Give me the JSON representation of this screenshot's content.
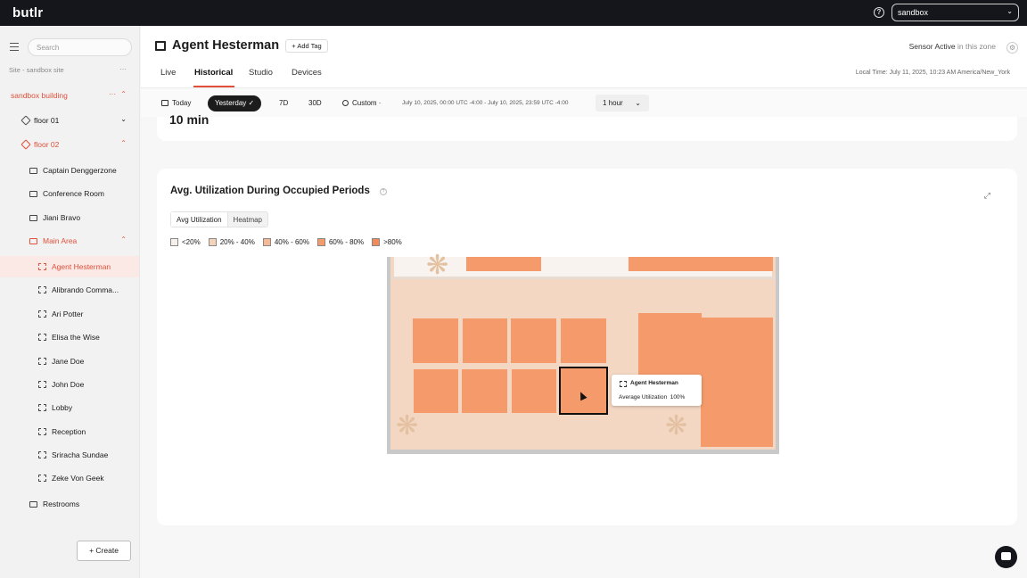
{
  "app": {
    "logo": "butlr",
    "org_select": "sandbox"
  },
  "sidebar": {
    "search_placeholder": "Search",
    "site_label": "Site - sandbox site",
    "site_more": "···",
    "building": {
      "label": "sandbox building",
      "more": "···"
    },
    "floors": [
      {
        "label": "floor 01"
      },
      {
        "label": "floor 02"
      }
    ],
    "rooms": [
      "Captain Denggerzone",
      "Conference Room",
      "Jiani Bravo"
    ],
    "main_area": "Main Area",
    "zones": [
      "Agent Hesterman",
      "Alibrando Comma...",
      "Ari Potter",
      "Elisa the Wise",
      "Jane Doe",
      "John Doe",
      "Lobby",
      "Reception",
      "Sriracha Sundae",
      "Zeke Von Geek"
    ],
    "restrooms": "Restrooms",
    "create_label": "+  Create"
  },
  "header": {
    "title": "Agent Hesterman",
    "add_tag": "+ Add Tag",
    "sensor_status": "Sensor Active",
    "sensor_suffix": " in this zone",
    "tabs": [
      "Live",
      "Historical",
      "Studio",
      "Devices"
    ],
    "active_tab": "Historical",
    "local_time": "Local Time: July 11, 2025, 10:23 AM America/New_York"
  },
  "filters": {
    "today": "Today",
    "yesterday": "Yesterday ✓",
    "seven_d": "7D",
    "thirty_d": "30D",
    "custom": "Custom ·",
    "date_range": "July 10, 2025, 00:00 UTC -4:00   -   July 10, 2025, 23:59 UTC -4:00",
    "interval": "1 hour"
  },
  "top_card": {
    "value": "10 min"
  },
  "util_card": {
    "title": "Avg. Utilization During Occupied Periods",
    "toggle": [
      "Avg Utilization",
      "Heatmap"
    ],
    "legend": [
      {
        "label": "<20%",
        "color": "#f7efe9"
      },
      {
        "label": "20% - 40%",
        "color": "#f3d3b9"
      },
      {
        "label": "40% - 60%",
        "color": "#f4b892"
      },
      {
        "label": "60% - 80%",
        "color": "#f49a6b"
      },
      {
        "label": ">80%",
        "color": "#ef8a5a"
      }
    ]
  },
  "tooltip": {
    "title": "Agent Hesterman",
    "metric": "Average Utilization",
    "value": "100%"
  },
  "colors": {
    "accent": "#e0503a",
    "zone_fill": "#f49a6b",
    "floor_fill": "#f3d7c3"
  }
}
